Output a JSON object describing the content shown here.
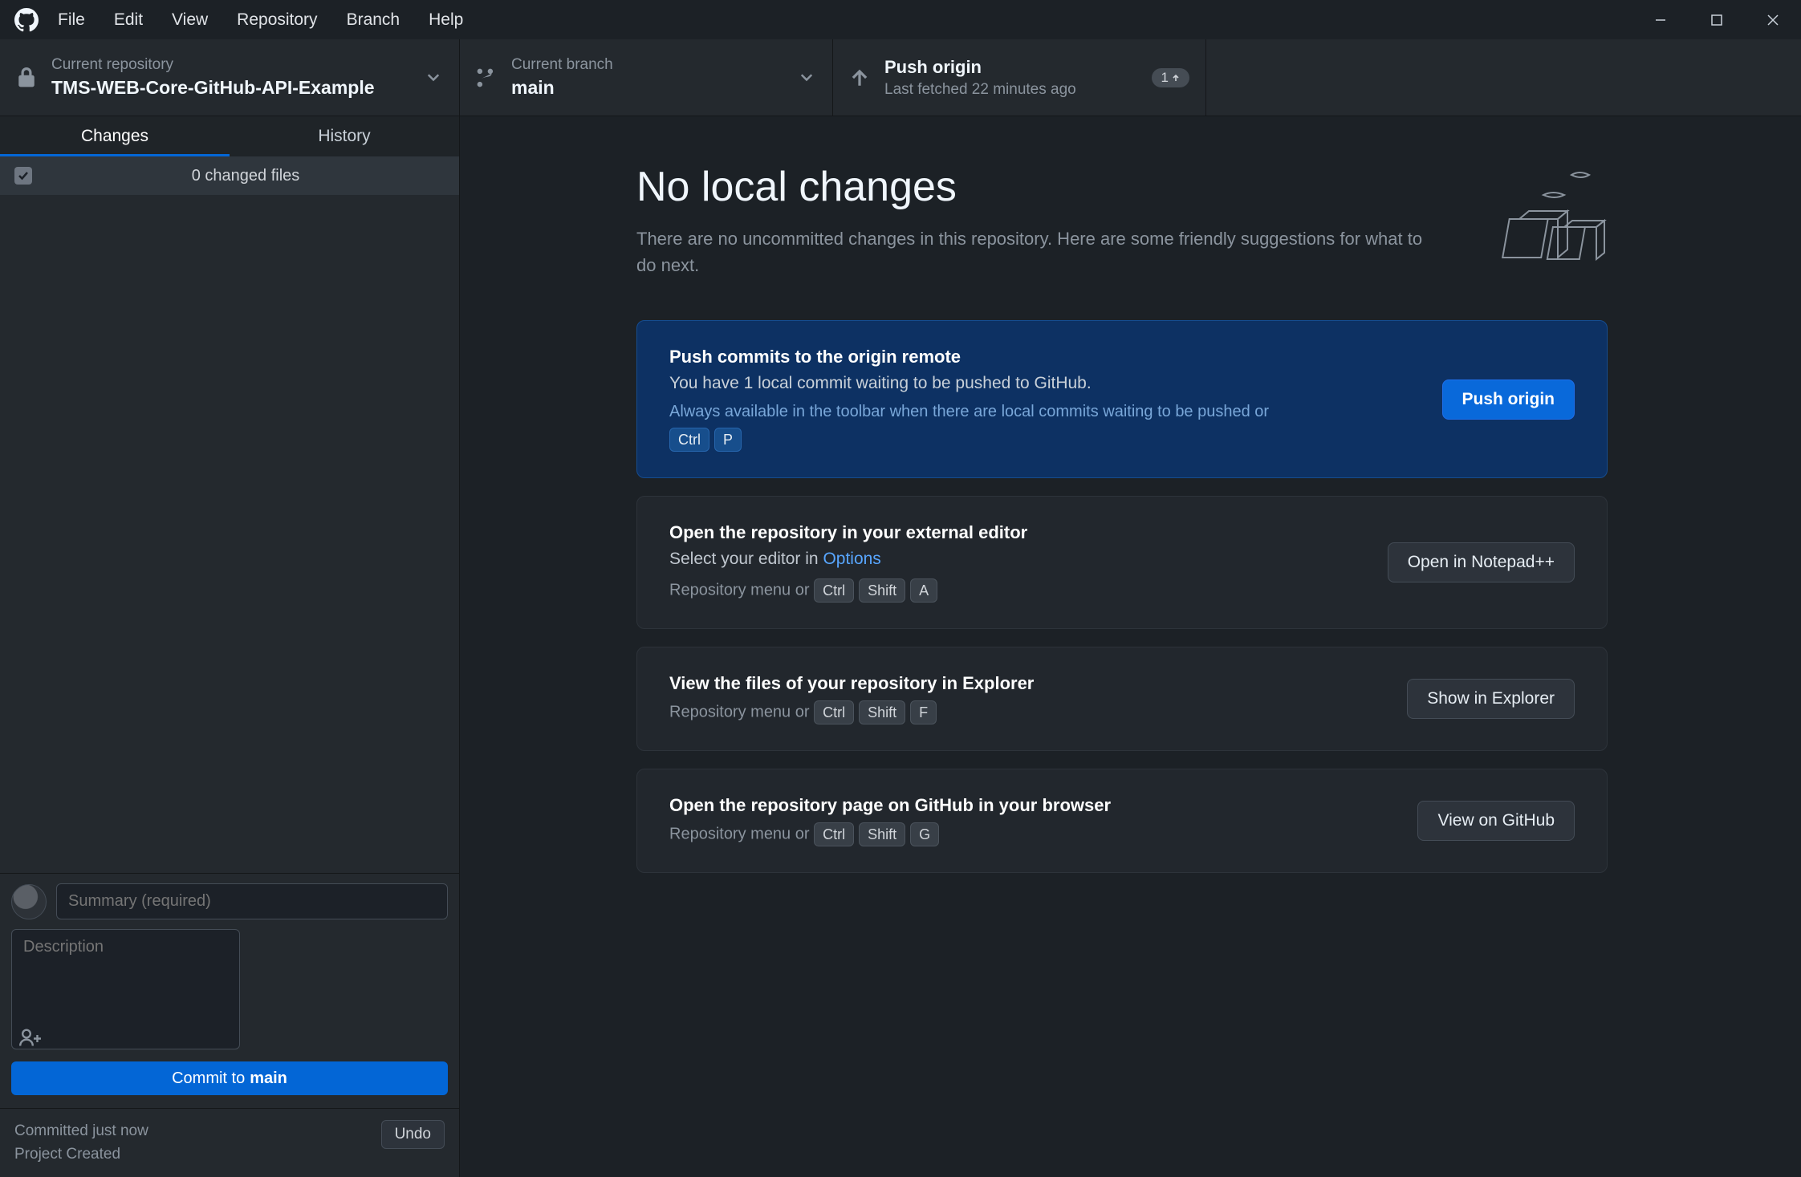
{
  "menu": {
    "items": [
      "File",
      "Edit",
      "View",
      "Repository",
      "Branch",
      "Help"
    ]
  },
  "toolbar": {
    "repo": {
      "label": "Current repository",
      "value": "TMS-WEB-Core-GitHub-API-Example"
    },
    "branch": {
      "label": "Current branch",
      "value": "main"
    },
    "push": {
      "label": "Push origin",
      "sub": "Last fetched 22 minutes ago",
      "badge": "1"
    }
  },
  "tabs": {
    "changes": "Changes",
    "history": "History"
  },
  "changes_header": "0 changed files",
  "commit_form": {
    "summary_placeholder": "Summary (required)",
    "description_placeholder": "Description",
    "commit_prefix": "Commit to ",
    "commit_branch": "main"
  },
  "commit_footer": {
    "line1": "Committed just now",
    "line2": "Project Created",
    "undo": "Undo"
  },
  "hero": {
    "title": "No local changes",
    "subtitle": "There are no uncommitted changes in this repository. Here are some friendly suggestions for what to do next."
  },
  "cards": {
    "push": {
      "title": "Push commits to the origin remote",
      "desc": "You have 1 local commit waiting to be pushed to GitHub.",
      "hint": "Always available in the toolbar when there are local commits waiting to be pushed or",
      "keys": [
        "Ctrl",
        "P"
      ],
      "button": "Push origin"
    },
    "editor": {
      "title": "Open the repository in your external editor",
      "desc_prefix": "Select your editor in ",
      "desc_link": "Options",
      "hint_prefix": "Repository menu or",
      "keys": [
        "Ctrl",
        "Shift",
        "A"
      ],
      "button": "Open in Notepad++"
    },
    "explorer": {
      "title": "View the files of your repository in Explorer",
      "hint_prefix": "Repository menu or",
      "keys": [
        "Ctrl",
        "Shift",
        "F"
      ],
      "button": "Show in Explorer"
    },
    "github": {
      "title": "Open the repository page on GitHub in your browser",
      "hint_prefix": "Repository menu or",
      "keys": [
        "Ctrl",
        "Shift",
        "G"
      ],
      "button": "View on GitHub"
    }
  }
}
